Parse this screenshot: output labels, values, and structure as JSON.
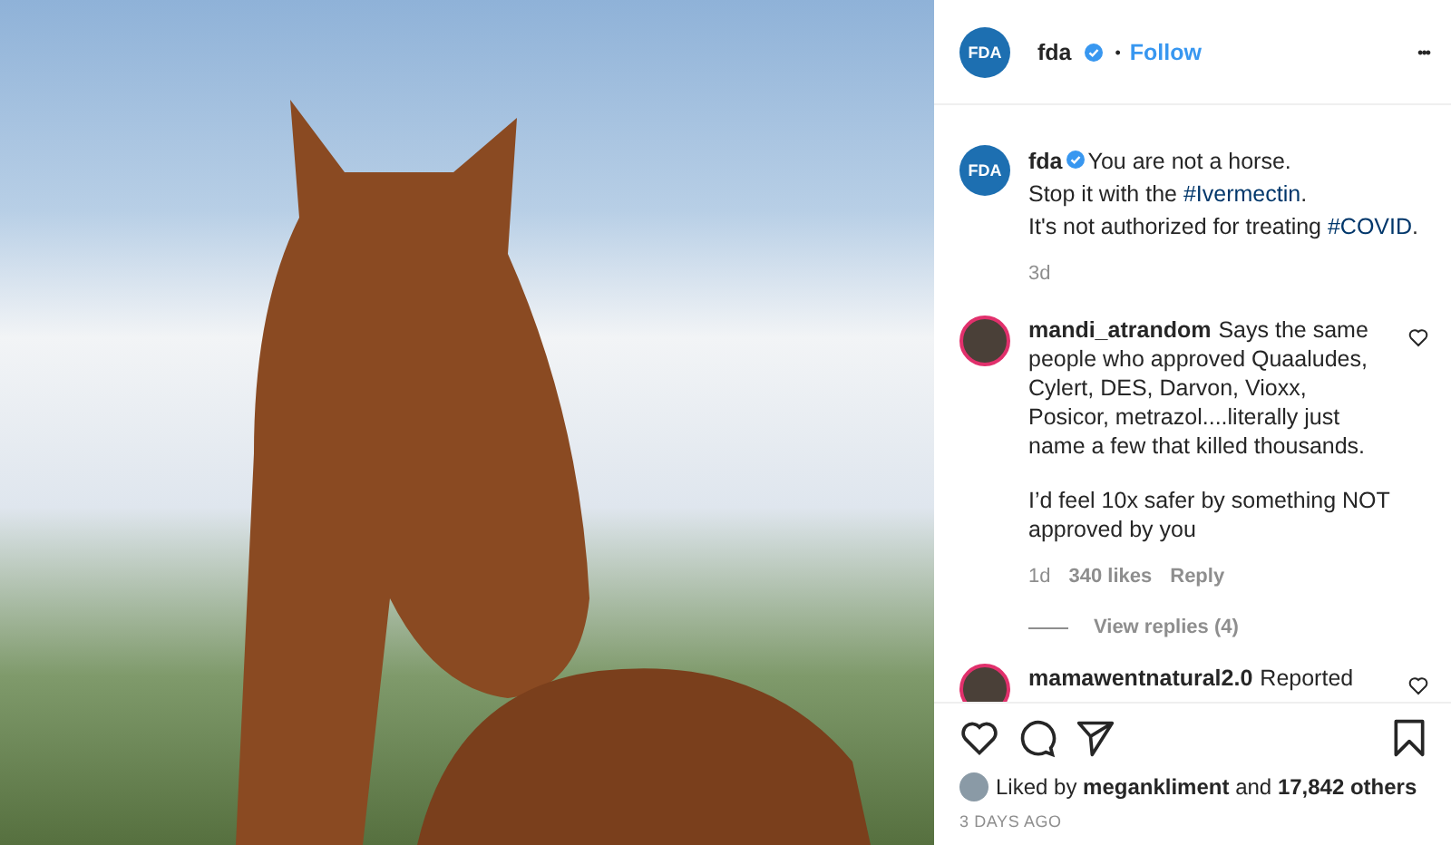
{
  "header": {
    "avatar": "FDA",
    "username": "fda",
    "verified": true,
    "separator": "•",
    "follow": "Follow",
    "more": "•••"
  },
  "caption": {
    "avatar": "FDA",
    "username": "fda",
    "verified": true,
    "lines": [
      [
        {
          "kind": "text",
          "text": "You are not a horse."
        }
      ],
      [
        {
          "kind": "text",
          "text": "Stop it with the "
        },
        {
          "kind": "tag",
          "text": "#Ivermectin"
        },
        {
          "kind": "text",
          "text": "."
        }
      ],
      [
        {
          "kind": "text",
          "text": "It's not authorized for treating "
        },
        {
          "kind": "tag",
          "text": "#COVID"
        },
        {
          "kind": "text",
          "text": "."
        }
      ]
    ],
    "time": "3d"
  },
  "comments": [
    {
      "username": "mandi_atrandom",
      "paragraphs": [
        "Says the same people who approved Quaaludes, Cylert, DES, Darvon, Vioxx, Posicor, metrazol....literally just name a few that killed thousands.",
        "I’d feel 10x safer by something NOT approved by you"
      ],
      "time": "1d",
      "likes": "340 likes",
      "reply": "Reply",
      "view_replies": "View replies (4)",
      "liked": false
    },
    {
      "username": "mamawentnatural2.0",
      "paragraphs": [
        "Reported"
      ],
      "liked": false
    }
  ],
  "likes": {
    "prefix": "Liked by ",
    "user": "megankliment",
    "middle": " and ",
    "count": "17,842 others"
  },
  "date": "3 DAYS AGO"
}
